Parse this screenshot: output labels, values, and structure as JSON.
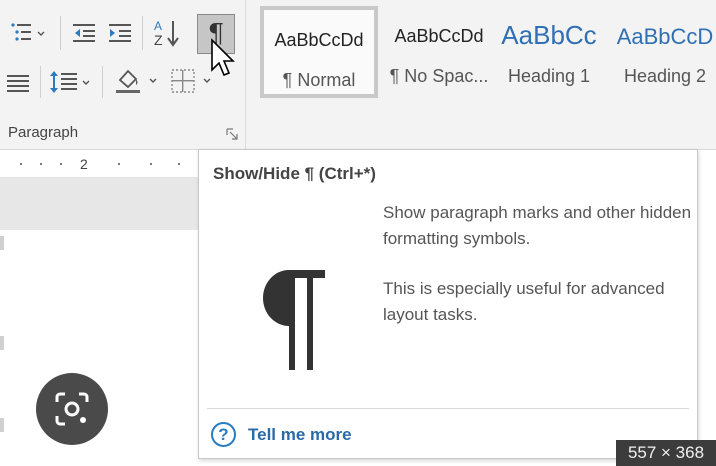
{
  "ribbon": {
    "paragraph_group_label": "Paragraph",
    "show_hide_symbol": "¶",
    "styles": [
      {
        "preview": "AaBbCcDd",
        "name": "¶ Normal",
        "selected": true
      },
      {
        "preview": "AaBbCcDd",
        "name": "¶ No Spac...",
        "selected": false
      },
      {
        "preview": "AaBbCc",
        "name": "Heading 1",
        "selected": false
      },
      {
        "preview": "AaBbCcD",
        "name": "Heading 2",
        "selected": false
      }
    ]
  },
  "ruler": {
    "label": "2"
  },
  "tooltip": {
    "title": "Show/Hide ¶ (Ctrl+*)",
    "description": "Show paragraph marks and other hidden formatting symbols.",
    "detail": "This is especially useful for advanced layout tasks.",
    "help_link": "Tell me more",
    "help_icon_symbol": "?"
  },
  "overlay": {
    "image_size": "557 × 368"
  },
  "colors": {
    "accent_blue": "#2a7bc0",
    "heading_blue": "#2f6fb3",
    "ribbon_bg": "#f3f3f3"
  }
}
